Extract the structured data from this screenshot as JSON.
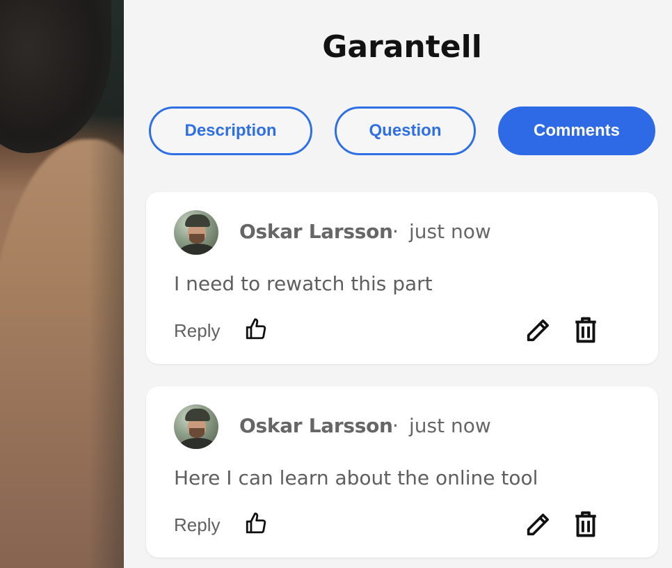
{
  "header": {
    "title": "Garantell"
  },
  "tabs": [
    {
      "label": "Description",
      "active": false
    },
    {
      "label": "Question",
      "active": false
    },
    {
      "label": "Comments",
      "active": true
    }
  ],
  "comments": [
    {
      "author": "Oskar Larsson",
      "separator": "·",
      "time": "just now",
      "text": "I need to rewatch this part",
      "reply_label": "Reply",
      "icons": [
        "thumbs-up-icon",
        "pencil-icon",
        "trash-icon"
      ]
    },
    {
      "author": "Oskar Larsson",
      "separator": "·",
      "time": "just now",
      "text": "Here I can learn about the online tool",
      "reply_label": "Reply",
      "icons": [
        "thumbs-up-icon",
        "pencil-icon",
        "trash-icon"
      ]
    }
  ],
  "colors": {
    "accent": "#2f6ae6",
    "background": "#f4f4f4",
    "card": "#ffffff",
    "muted_text": "#666666"
  }
}
